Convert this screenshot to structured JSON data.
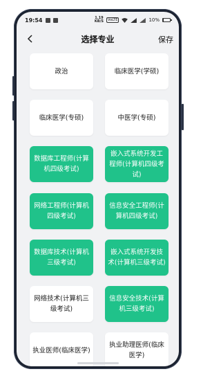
{
  "status_bar": {
    "time": "19:54",
    "net_speed_value": "1.19",
    "net_speed_unit": "KB/S",
    "network_badge": "VoLTE",
    "battery_text": "10%"
  },
  "nav": {
    "title": "选择专业",
    "save_label": "保存"
  },
  "majors": [
    {
      "label": "政治",
      "selected": false
    },
    {
      "label": "临床医学(学硕)",
      "selected": false
    },
    {
      "label": "临床医学(专硕)",
      "selected": false
    },
    {
      "label": "中医学(专硕)",
      "selected": false
    },
    {
      "label": "数据库工程师(计算机四级考试)",
      "selected": true
    },
    {
      "label": "嵌入式系统开发工程师(计算机四级考试)",
      "selected": true
    },
    {
      "label": "网络工程师(计算机四级考试)",
      "selected": true
    },
    {
      "label": "信息安全工程师(计算机四级考试)",
      "selected": true
    },
    {
      "label": "数据库技术(计算机三级考试)",
      "selected": true
    },
    {
      "label": "嵌入式系统开发技术(计算机三级考试)",
      "selected": true
    },
    {
      "label": "网络技术(计算机三级考试)",
      "selected": false
    },
    {
      "label": "信息安全技术(计算机三级考试)",
      "selected": true
    },
    {
      "label": "执业医师(临床医学)",
      "selected": false
    },
    {
      "label": "执业助理医师(临床医学)",
      "selected": false
    }
  ],
  "colors": {
    "selected": "#20c28a",
    "unselected": "#ffffff",
    "screen_bg": "#f1f2f4"
  }
}
